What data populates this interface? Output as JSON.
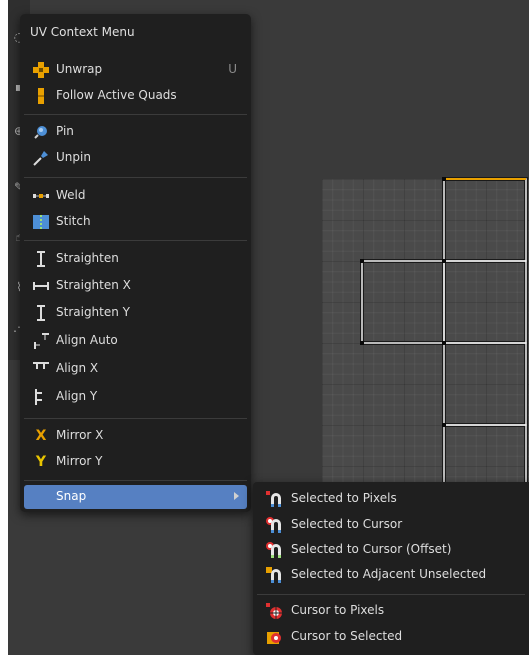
{
  "main_menu": {
    "title": "UV Context Menu",
    "unwrap": {
      "label": "Unwrap",
      "shortcut": "U"
    },
    "follow_active_quads": {
      "label": "Follow Active Quads"
    },
    "pin": {
      "label": "Pin"
    },
    "unpin": {
      "label": "Unpin"
    },
    "weld": {
      "label": "Weld"
    },
    "stitch": {
      "label": "Stitch"
    },
    "straighten": {
      "label": "Straighten"
    },
    "straighten_x": {
      "label": "Straighten X"
    },
    "straighten_y": {
      "label": "Straighten Y"
    },
    "align_auto": {
      "label": "Align Auto"
    },
    "align_x": {
      "label": "Align X"
    },
    "align_y": {
      "label": "Align Y"
    },
    "mirror_x": {
      "label": "Mirror X"
    },
    "mirror_y": {
      "label": "Mirror Y"
    },
    "snap": {
      "label": "Snap"
    }
  },
  "snap_submenu": {
    "selected_to_pixels": "Selected to Pixels",
    "selected_to_cursor": "Selected to Cursor",
    "selected_to_cursor_offset": "Selected to Cursor (Offset)",
    "selected_to_adjacent_unselected": "Selected to Adjacent Unselected",
    "cursor_to_pixels": "Cursor to Pixels",
    "cursor_to_selected": "Cursor to Selected"
  },
  "icons": {
    "unwrap": "unwrap-icon",
    "follow_active_quads": "follow-active-quads-icon",
    "pin": "pin-icon",
    "unpin": "unpin-icon",
    "weld": "weld-icon",
    "stitch": "stitch-icon",
    "straighten": "straighten-icon",
    "align": "align-icon",
    "mirror_x": "mirror-x-icon",
    "mirror_y": "mirror-y-icon",
    "snap": "snap-magnet-icon"
  },
  "colors": {
    "menu_bg": "#1f1f1f",
    "highlight": "#5680c2",
    "editor_bg": "#3a3a3a",
    "accent_orange": "#e8a000",
    "accent_blue": "#4d8fd6"
  }
}
